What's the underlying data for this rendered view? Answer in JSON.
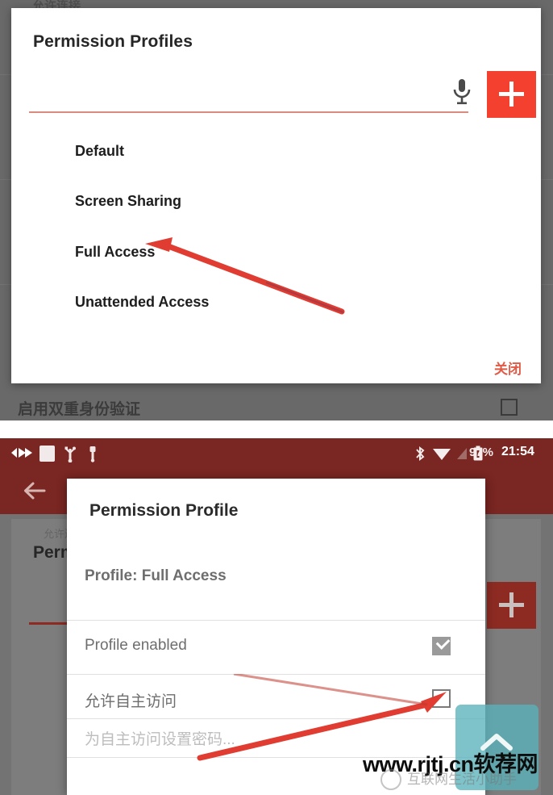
{
  "panel_one": {
    "background_text_top": "允许连接",
    "background_text_bottom": "启用双重身份验证",
    "dialog": {
      "title": "Permission Profiles",
      "input_value": "",
      "input_placeholder": "",
      "mic_icon": "microphone-icon",
      "add_button_icon": "plus-icon",
      "items": [
        {
          "label": "Default"
        },
        {
          "label": "Screen Sharing"
        },
        {
          "label": "Full Access"
        },
        {
          "label": "Unattended Access"
        }
      ],
      "close_label": "关闭"
    },
    "annotation_arrow": "red-arrow-pointing-to-full-access"
  },
  "panel_two": {
    "status_bar": {
      "left_icons": [
        "data-transfer-icon",
        "white-square-icon",
        "usb-icon",
        "usb-plug-icon"
      ],
      "right_icons": [
        "bluetooth-icon",
        "wifi-icon",
        "signal-icon",
        "battery-icon"
      ],
      "battery_percent": "97%",
      "clock": "21:54"
    },
    "toolbar": {
      "back_icon": "back-arrow-icon"
    },
    "background_dialog": {
      "title": "Perm",
      "scrim_text": "允许连接",
      "add_button_icon": "plus-icon"
    },
    "dialog": {
      "title": "Permission Profile",
      "subtitle": "Profile: Full Access",
      "rows": [
        {
          "label": "Profile enabled",
          "checked": true
        },
        {
          "label": "允许自主访问",
          "checked": false
        }
      ],
      "password_placeholder": "为自主访问设置密码..."
    },
    "annotation_arrow": "red-arrow-pointing-to-unchecked-checkbox",
    "scroll_top": {
      "icon": "chevron-up-icon"
    }
  },
  "watermark": {
    "url": "www.rjtj.cn软荐网",
    "subtitle": "互联网生活小助手"
  },
  "colors": {
    "accent_red": "#f4402e",
    "toolbar_red": "#7a2622",
    "scrim_gray": "#696969",
    "close_red": "#e05a45",
    "scroll_top_teal": "#58b2ba"
  }
}
